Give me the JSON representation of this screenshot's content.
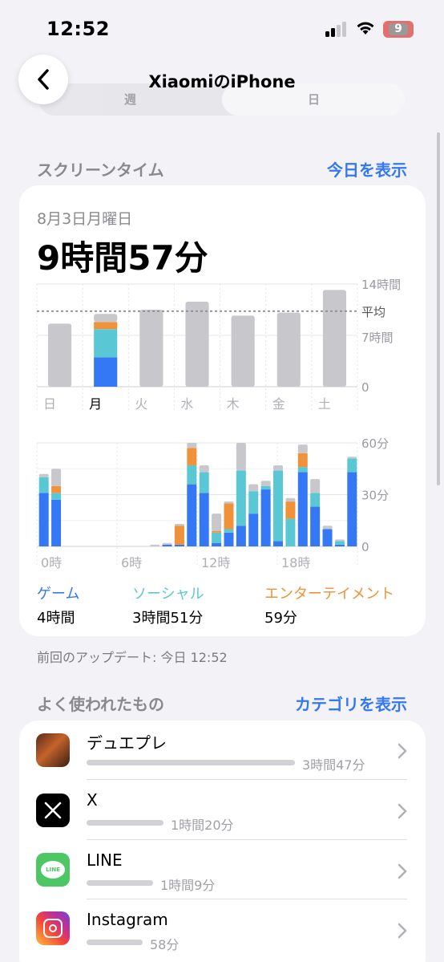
{
  "status": {
    "time": "12:52",
    "battery": "9"
  },
  "nav": {
    "title": "XiaomiのiPhone",
    "segments": [
      "週",
      "日"
    ],
    "selected": 1
  },
  "screen_time": {
    "section_title": "スクリーンタイム",
    "section_link": "今日を表示",
    "date": "8月3日月曜日",
    "total": "9時間57分"
  },
  "chart_data": [
    {
      "type": "bar",
      "categories": [
        "日",
        "月",
        "火",
        "水",
        "木",
        "金",
        "土"
      ],
      "values": [
        8.6,
        9.9,
        10.5,
        11.6,
        9.7,
        10.1,
        13.2
      ],
      "highlight_index": 1,
      "breakdown_selected": {
        "ゲーム": 4.0,
        "ソーシャル": 3.85,
        "エンターテイメント": 0.98,
        "その他": 1.1
      },
      "average_label": "平均",
      "y_ticks": [
        "14時間",
        "7時間",
        "0"
      ],
      "ylim": [
        0,
        14
      ],
      "average": 10.3
    },
    {
      "type": "bar",
      "stacked": true,
      "x_ticks": [
        "0時",
        "6時",
        "12時",
        "18時"
      ],
      "y_ticks": [
        "60分",
        "30分",
        "0"
      ],
      "ylim": [
        0,
        60
      ],
      "series": [
        {
          "name": "ゲーム",
          "values": [
            31,
            27,
            0,
            0,
            0,
            0,
            0,
            0,
            0,
            0,
            1,
            1,
            36,
            31,
            2,
            8,
            12,
            19,
            33,
            3,
            0,
            43,
            23,
            10,
            1,
            43
          ]
        },
        {
          "name": "ソーシャル",
          "values": [
            9,
            4,
            0,
            0,
            0,
            0,
            0,
            0,
            0,
            0,
            0,
            0,
            11,
            12,
            6,
            2,
            32,
            13,
            2,
            41,
            16,
            3,
            8,
            0,
            2,
            8
          ]
        },
        {
          "name": "エンターテイメント",
          "values": [
            0,
            4,
            0,
            0,
            0,
            0,
            0,
            0,
            0,
            0,
            0,
            11,
            10,
            0,
            1,
            15,
            0,
            0,
            0,
            0,
            10,
            8,
            0,
            0,
            0,
            0
          ]
        },
        {
          "name": "その他",
          "values": [
            2,
            10,
            0,
            0,
            0,
            0,
            0,
            0,
            0,
            1,
            1,
            1,
            3,
            4,
            10,
            1,
            16,
            4,
            3,
            3,
            2,
            5,
            8,
            2,
            1,
            1
          ]
        }
      ]
    }
  ],
  "categories": [
    {
      "name": "ゲーム",
      "value": "4時間",
      "color": "#3478f6"
    },
    {
      "name": "ソーシャル",
      "value": "3時間51分",
      "color": "#5ac8d4"
    },
    {
      "name": "エンターテイメント",
      "value": "59分",
      "color": "#f0923a"
    }
  ],
  "updated": "前回のアップデート: 今日 12:52",
  "most_used": {
    "section_title": "よく使われたもの",
    "section_link": "カテゴリを表示",
    "apps": [
      {
        "name": "デュエプレ",
        "duration": "3時間47分",
        "fraction": 1.0,
        "icon": "game-icon"
      },
      {
        "name": "X",
        "duration": "1時間20分",
        "fraction": 0.37,
        "icon": "x-icon"
      },
      {
        "name": "LINE",
        "duration": "1時間9分",
        "fraction": 0.32,
        "icon": "line-icon"
      },
      {
        "name": "Instagram",
        "duration": "58分",
        "fraction": 0.27,
        "icon": "instagram-icon"
      }
    ]
  },
  "colors": {
    "game": "#3478f6",
    "social": "#5ac8d4",
    "entertainment": "#f0923a",
    "other": "#c7c7cc",
    "link": "#3478f6"
  }
}
